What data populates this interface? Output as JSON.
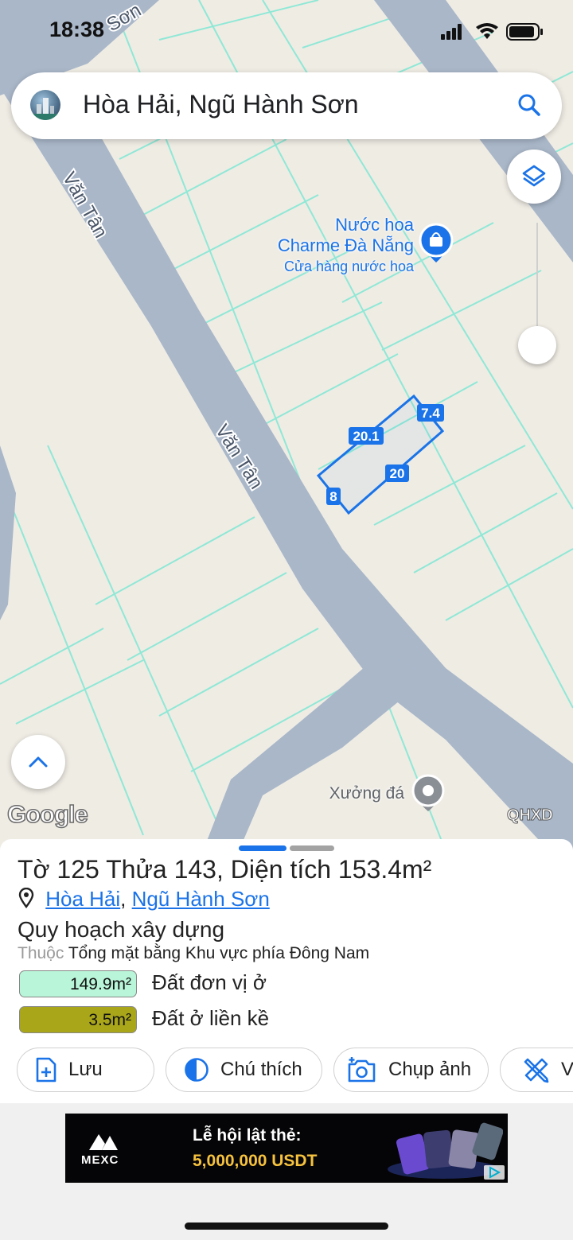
{
  "status_bar": {
    "time": "18:38"
  },
  "search": {
    "query": "Hòa Hải, Ngũ Hành Sơn"
  },
  "map": {
    "street_labels": [
      "Văn Tân",
      "Văn Tân",
      "Sơn"
    ],
    "poi_perfume": {
      "name_line1": "Nước hoa",
      "name_line2": "Charme Đà Nẵng",
      "category": "Cửa hàng nước hoa"
    },
    "poi_workshop": {
      "name": "Xưởng đá"
    },
    "parcel_edges": [
      "20.1",
      "7.4",
      "20",
      "8"
    ],
    "attribution": "Google",
    "layer_badge": "QHXD"
  },
  "sheet": {
    "title_prefix": "Tờ",
    "sheet_no": "125",
    "plot_label": "Thửa",
    "plot_no": "143",
    "area_label": "Diện tích",
    "area_value": "153.4m²",
    "location_ward": "Hòa Hải",
    "location_sep": ",",
    "location_district": "Ngũ Hành Sơn",
    "planning_title": "Quy hoạch xây dựng",
    "belongs_prefix": "Thuộc",
    "belongs_to": "Tổng mặt bằng Khu vực phía Đông Nam",
    "zones": [
      {
        "area": "149.9m²",
        "label": "Đất đơn vị ở",
        "color": "#b9f5d8"
      },
      {
        "area": "3.5m²",
        "label": "Đất ở liền kề",
        "color": "#a9a61a"
      }
    ],
    "actions": [
      "Lưu",
      "Chú thích",
      "Chụp ảnh",
      "V"
    ]
  },
  "ad": {
    "brand": "MEXC",
    "line1": "Lễ hội lật thẻ:",
    "line2": "5,000,000 USDT"
  },
  "colors": {
    "accent": "#1a73e8",
    "road": "#a9b7c9",
    "land": "#efece4",
    "parcel_lines": "#8fe8d6"
  }
}
